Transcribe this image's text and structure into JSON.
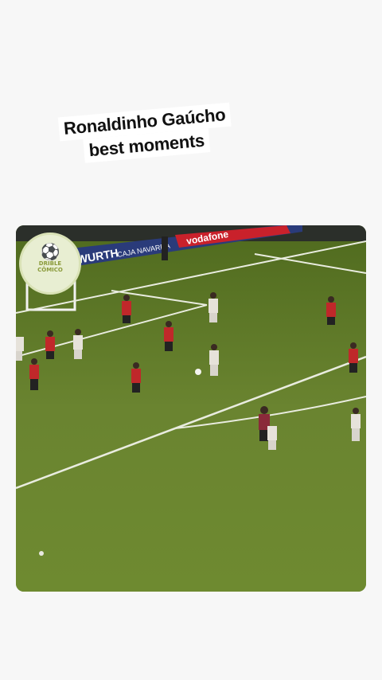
{
  "caption": {
    "line1": "Ronaldinho Gaúcho",
    "line2": "best moments"
  },
  "video": {
    "ad_boards": [
      "WURTH",
      "CAJA NAVARRA",
      "vodafone"
    ],
    "watermark": {
      "icon": "player-trophy-icon",
      "line1": "DRIBLE",
      "line2": "CÔMICO"
    }
  },
  "colors": {
    "background": "#f7f7f7",
    "pitch": "#5f7a2a",
    "team_red": "#c0282a",
    "team_white": "#e6e2da"
  }
}
